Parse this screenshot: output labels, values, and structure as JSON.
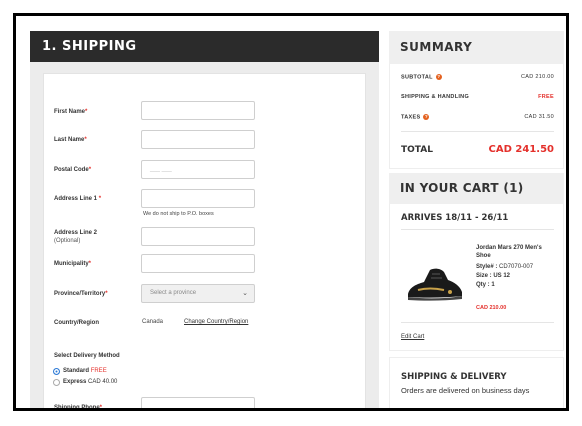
{
  "shipping": {
    "title": "1. SHIPPING",
    "fields": {
      "first_name": "First Name",
      "last_name": "Last Name",
      "postal_code": "Postal Code",
      "postal_placeholder": "___ ___",
      "address1": "Address Line 1",
      "address1_hint": "We do not ship to P.O. boxes",
      "address2": "Address Line 2",
      "address2_sub": "(Optional)",
      "municipality": "Municipality",
      "province": "Province/Territory",
      "province_placeholder": "Select a province",
      "country": "Country/Region",
      "country_value": "Canada",
      "change_country": "Change Country/Region",
      "delivery_method": "Select Delivery Method",
      "standard": "Standard",
      "standard_price": "FREE",
      "express": "Express",
      "express_price": "CAD 40.00",
      "phone": "Shipping Phone"
    },
    "required_mark": "*"
  },
  "summary": {
    "title": "SUMMARY",
    "subtotal_label": "SUBTOTAL",
    "subtotal_value": "CAD 210.00",
    "shipping_label": "SHIPPING & HANDLING",
    "shipping_value": "FREE",
    "taxes_label": "TAXES",
    "taxes_value": "CAD 31.50",
    "total_label": "TOTAL",
    "total_value": "CAD 241.50",
    "info_glyph": "?"
  },
  "cart": {
    "title": "IN YOUR CART (1)",
    "arrives": "ARRIVES 18/11 - 26/11",
    "product_name": "Jordan Mars 270 Men's Shoe",
    "style_label": "Style# :",
    "style_value": "CD7070-007",
    "size_label": "Size :",
    "size_value": "US 12",
    "qty_label": "Qty :",
    "qty_value": "1",
    "price": "CAD 210.00",
    "edit": "Edit Cart"
  },
  "delivery": {
    "title": "SHIPPING & DELIVERY",
    "text": "Orders are delivered on business days"
  },
  "colors": {
    "accent_red": "#e4302b",
    "header_dark": "#2b2b2b",
    "radio_blue": "#2e7bd6",
    "info_orange": "#e4611f"
  }
}
